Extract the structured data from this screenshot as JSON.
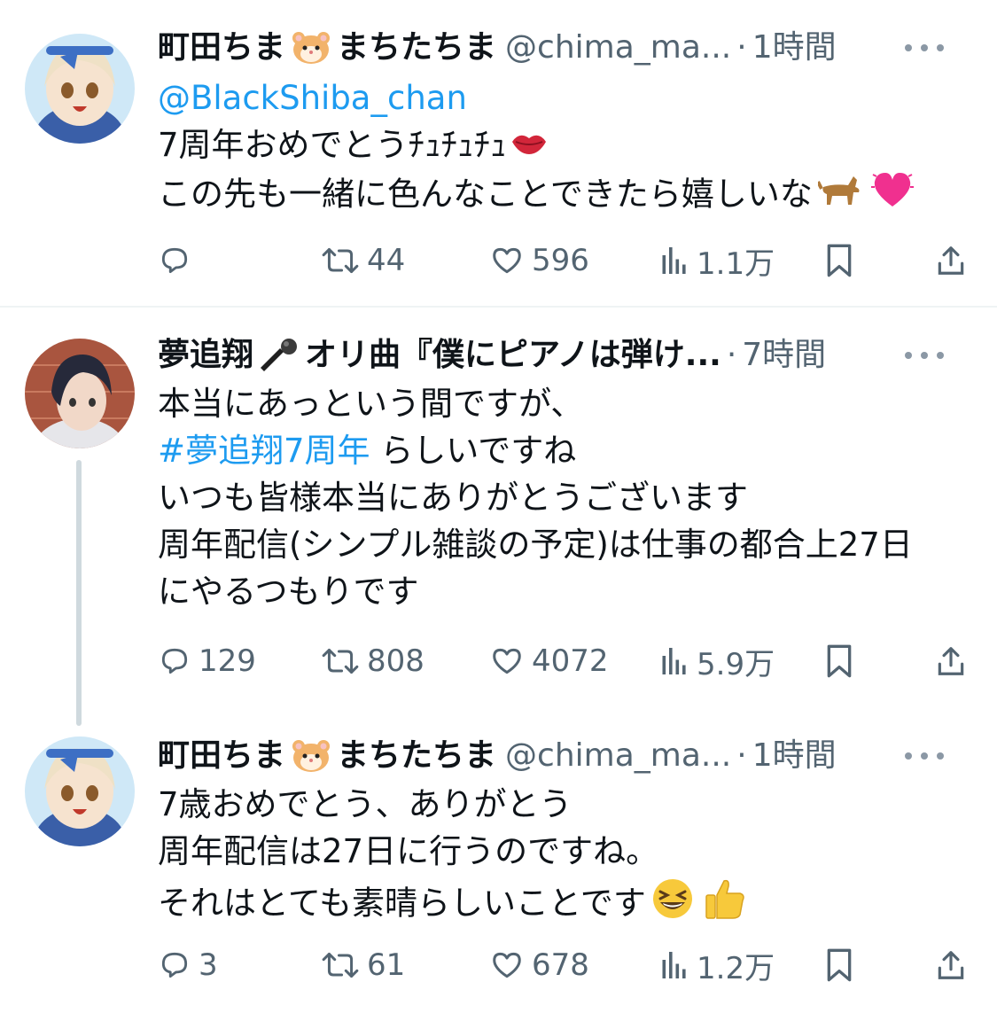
{
  "tweets": [
    {
      "display_name_a": "町田ちま",
      "display_name_b": "まちたちま",
      "handle": "@chima_ma...",
      "dot": "·",
      "time": "1時間",
      "lines": [
        {
          "link": "@BlackShiba_chan"
        },
        {
          "text": "7周年おめでとうﾁｭﾁｭﾁｭ",
          "emoji": "kiss-lips-emoji"
        },
        {
          "text": "この先も一緒に色んなことできたら嬉しいな",
          "emoji": "dog-and-heart-emoji"
        }
      ],
      "stats": {
        "replies": "",
        "retweets": "44",
        "likes": "596",
        "views": "1.1万"
      }
    },
    {
      "display_name_a": "夢追翔",
      "display_name_b": "オリ曲『僕にピアノは弾け...",
      "handle": "",
      "dot": "·",
      "time": "7時間",
      "lines": [
        {
          "text": "本当にあっという間ですが、"
        },
        {
          "link": "#夢追翔7周年",
          "text": " らしいですね"
        },
        {
          "text": "いつも皆様本当にありがとうございます"
        },
        {
          "text": "周年配信(シンプル雑談の予定)は仕事の都合上27日"
        },
        {
          "text": "にやるつもりです"
        }
      ],
      "stats": {
        "replies": "129",
        "retweets": "808",
        "likes": "4072",
        "views": "5.9万"
      }
    },
    {
      "display_name_a": "町田ちま",
      "display_name_b": "まちたちま",
      "handle": "@chima_ma...",
      "dot": "·",
      "time": "1時間",
      "lines": [
        {
          "text": "7歳おめでとう、ありがとう"
        },
        {
          "text": "周年配信は27日に行うのですね。"
        },
        {
          "text": "それはとても素晴らしいことです",
          "emoji": "grin-and-thumbs-up-emoji"
        }
      ],
      "stats": {
        "replies": "3",
        "retweets": "61",
        "likes": "678",
        "views": "1.2万"
      }
    }
  ],
  "colors": {
    "link": "#1d9bf0",
    "secondary": "#536471",
    "divider": "#eff3f4",
    "thread": "#cfd9de"
  }
}
